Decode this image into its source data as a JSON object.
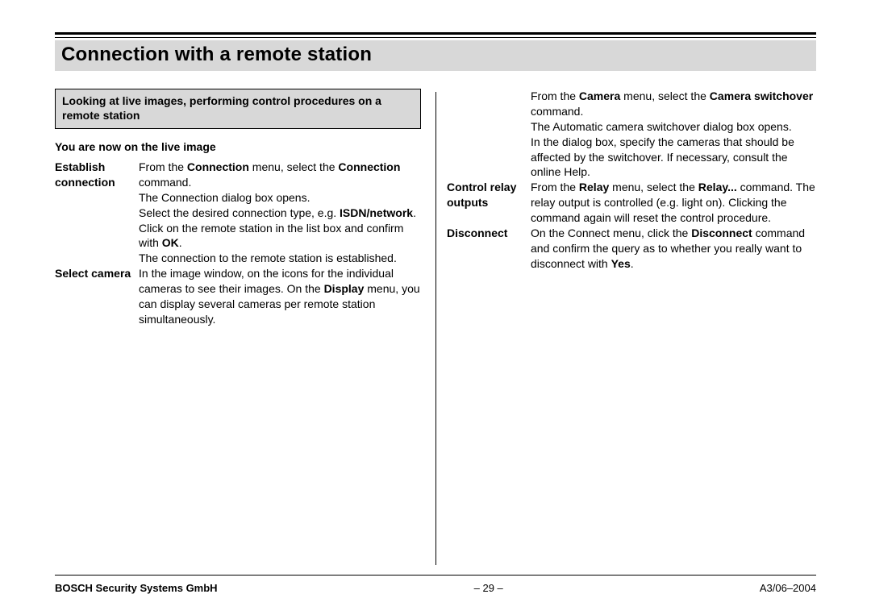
{
  "title": "Connection with a remote station",
  "left": {
    "boxed": "Looking at live images, performing control procedures on a remote station",
    "sub": "You are now on the live image",
    "items": [
      {
        "label": "Establish connection",
        "segments": [
          {
            "t": "From the "
          },
          {
            "b": "Connection"
          },
          {
            "t": " menu, select the "
          },
          {
            "b": "Connection"
          },
          {
            "t": " command."
          },
          {
            "br": true
          },
          {
            "t": "The Connection dialog box opens."
          },
          {
            "br": true
          },
          {
            "t": "Select the desired connection type, e.g. "
          },
          {
            "b": "ISDN/network"
          },
          {
            "t": "."
          },
          {
            "br": true
          },
          {
            "t": "Click on the remote station in the list box and confirm with "
          },
          {
            "b": "OK"
          },
          {
            "t": "."
          },
          {
            "br": true
          },
          {
            "t": "The connection to the remote station is established."
          }
        ]
      },
      {
        "label": "Select camera",
        "segments": [
          {
            "t": "In the image window, on the icons for the individual cameras to see their images. On the "
          },
          {
            "b": "Display"
          },
          {
            "t": " menu, you can display several cameras per remote station simultaneously."
          }
        ]
      }
    ]
  },
  "right": {
    "items": [
      {
        "label": "",
        "segments": [
          {
            "t": "From the "
          },
          {
            "b": "Camera"
          },
          {
            "t": " menu, select the "
          },
          {
            "b": "Camera switchover"
          },
          {
            "t": " command."
          },
          {
            "br": true
          },
          {
            "t": "The Automatic camera switchover dialog box opens."
          },
          {
            "br": true
          },
          {
            "t": "In the dialog box, specify the cameras that should be affected by the switchover. If necessary, consult the online Help."
          }
        ]
      },
      {
        "label": "Control relay outputs",
        "segments": [
          {
            "t": "From the "
          },
          {
            "b": "Relay"
          },
          {
            "t": " menu, select the "
          },
          {
            "b": "Relay..."
          },
          {
            "t": " command. The relay output is controlled (e.g. light on). Clicking the command again will reset the control procedure."
          }
        ]
      },
      {
        "label": "Disconnect",
        "segments": [
          {
            "t": "On the Connect menu, click the "
          },
          {
            "b": "Disconnect"
          },
          {
            "t": " command and confirm the query as to whether you really want to disconnect with "
          },
          {
            "b": "Yes"
          },
          {
            "t": "."
          }
        ]
      }
    ]
  },
  "footer": {
    "left": "BOSCH Security Systems GmbH",
    "mid": "–  29  –",
    "right": "A3/06–2004"
  }
}
